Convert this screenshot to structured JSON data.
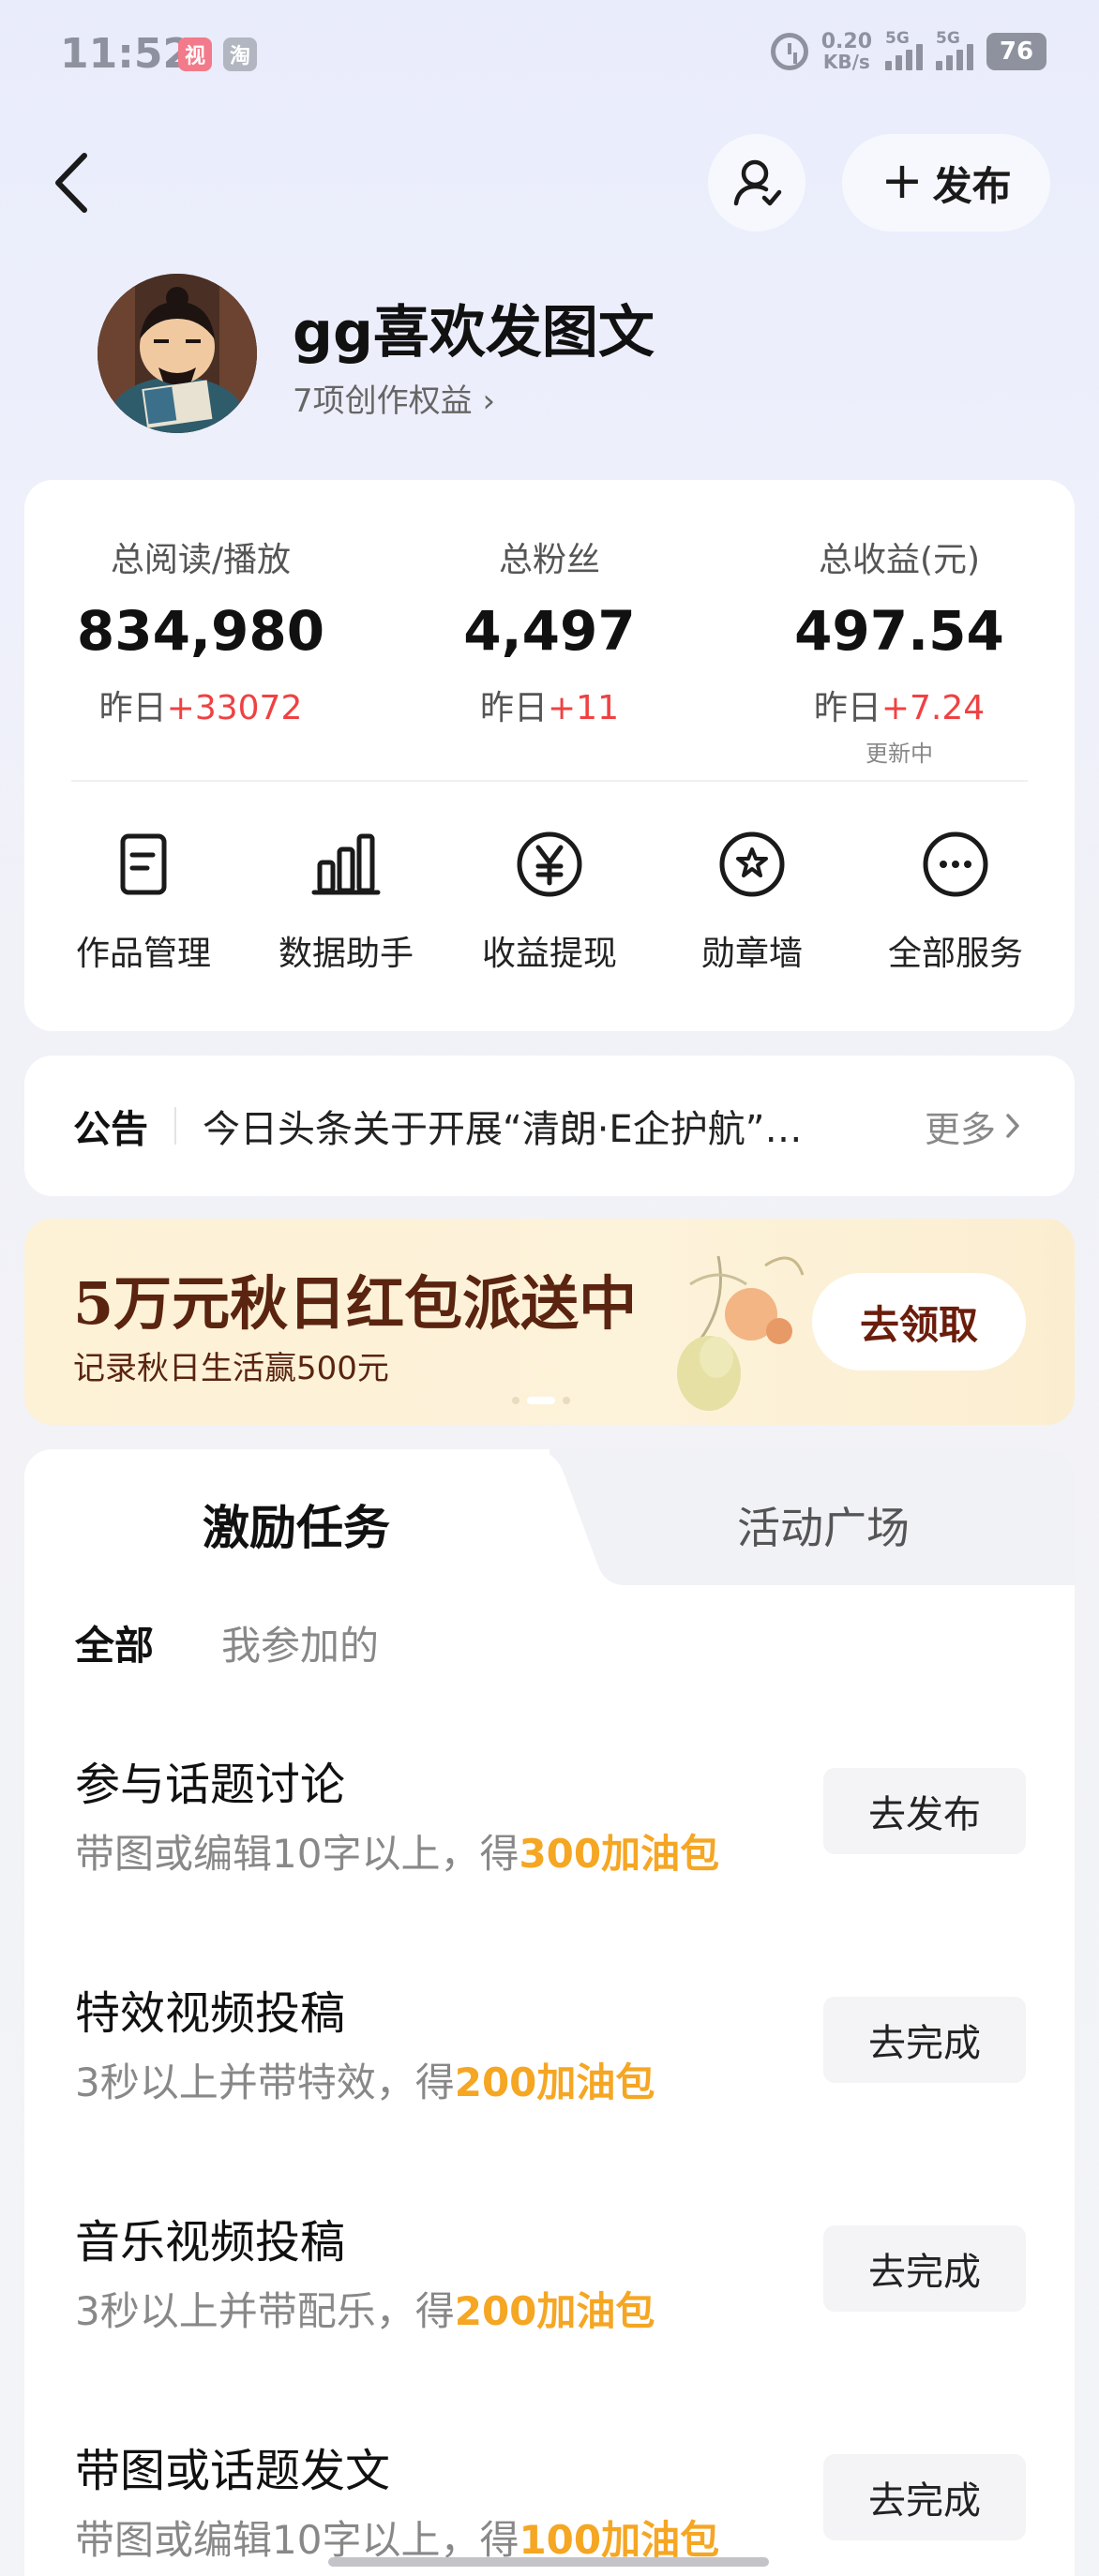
{
  "status_bar": {
    "time": "11:52",
    "app_badges": [
      "视",
      "淘"
    ],
    "speed_value": "0.20",
    "speed_unit": "KB/s",
    "signal_labels": [
      "5G",
      "5G"
    ],
    "battery": "76"
  },
  "header": {
    "publish_label": "发布"
  },
  "profile": {
    "username": "gg喜欢发图文",
    "rights_link": "7项创作权益 ›"
  },
  "stats": [
    {
      "label": "总阅读/播放",
      "value": "834,980",
      "delta_prefix": "昨日",
      "delta_value": "+33072",
      "note": ""
    },
    {
      "label": "总粉丝",
      "value": "4,497",
      "delta_prefix": "昨日",
      "delta_value": "+11",
      "note": ""
    },
    {
      "label": "总收益(元)",
      "value": "497.54",
      "delta_prefix": "昨日",
      "delta_value": "+7.24",
      "note": "更新中"
    }
  ],
  "services": [
    {
      "label": "作品管理",
      "icon": "document-icon"
    },
    {
      "label": "数据助手",
      "icon": "bar-chart-icon"
    },
    {
      "label": "收益提现",
      "icon": "yuan-icon"
    },
    {
      "label": "勋章墙",
      "icon": "medal-icon"
    },
    {
      "label": "全部服务",
      "icon": "more-icon"
    }
  ],
  "notice": {
    "title": "公告",
    "text": "今日头条关于开展“清朗·E企护航”专项行动的公告",
    "more": "更多"
  },
  "banner": {
    "title": "5万元秋日红包派送中",
    "subtitle": "记录秋日生活赢500元",
    "button": "去领取"
  },
  "tasks": {
    "tabs": [
      "激励任务",
      "活动广场"
    ],
    "filters": [
      "全部",
      "我参加的"
    ],
    "items": [
      {
        "title": "参与话题讨论",
        "desc_prefix": "带图或编辑10字以上，得",
        "reward": "300加油包",
        "button": "去发布"
      },
      {
        "title": "特效视频投稿",
        "desc_prefix": "3秒以上并带特效，得",
        "reward": "200加油包",
        "button": "去完成"
      },
      {
        "title": "音乐视频投稿",
        "desc_prefix": "3秒以上并带配乐，得",
        "reward": "200加油包",
        "button": "去完成"
      },
      {
        "title": "带图或话题发文",
        "desc_prefix": "带图或编辑10字以上，得",
        "reward": "100加油包",
        "button": "去完成"
      }
    ]
  },
  "colors": {
    "accent_red": "#f04142",
    "reward_orange": "#f5a623",
    "banner_text": "#5a2410"
  }
}
